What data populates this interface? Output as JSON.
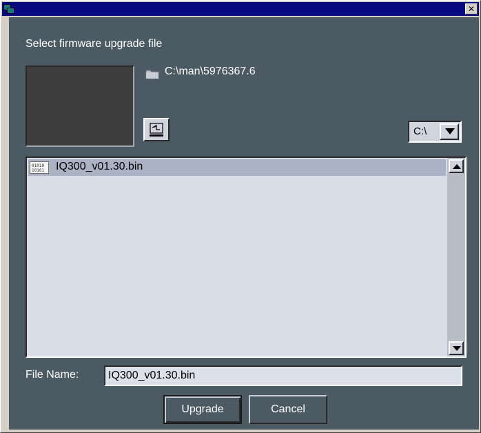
{
  "window": {
    "title_icon": "computer-network-icon",
    "close_label": "✕"
  },
  "heading": "Select firmware upgrade file",
  "path": {
    "icon": "folder-icon",
    "current": "C:\\man\\5976367.6"
  },
  "up_button": {
    "icon": "folder-up-icon"
  },
  "drive": {
    "selected": "C:\\",
    "icon": "chevron-down-icon"
  },
  "file_list": {
    "items": [
      {
        "icon": "binary-file-icon",
        "name": "IQ300_v01.30.bin",
        "selected": true
      }
    ]
  },
  "file_name": {
    "label": "File Name:",
    "value": "IQ300_v01.30.bin"
  },
  "buttons": {
    "upgrade": "Upgrade",
    "cancel": "Cancel"
  },
  "colors": {
    "panel": "#4b5a63",
    "titlebar": "#0a0a80",
    "list_bg": "#d8dce6",
    "selection": "#aab2c4"
  }
}
